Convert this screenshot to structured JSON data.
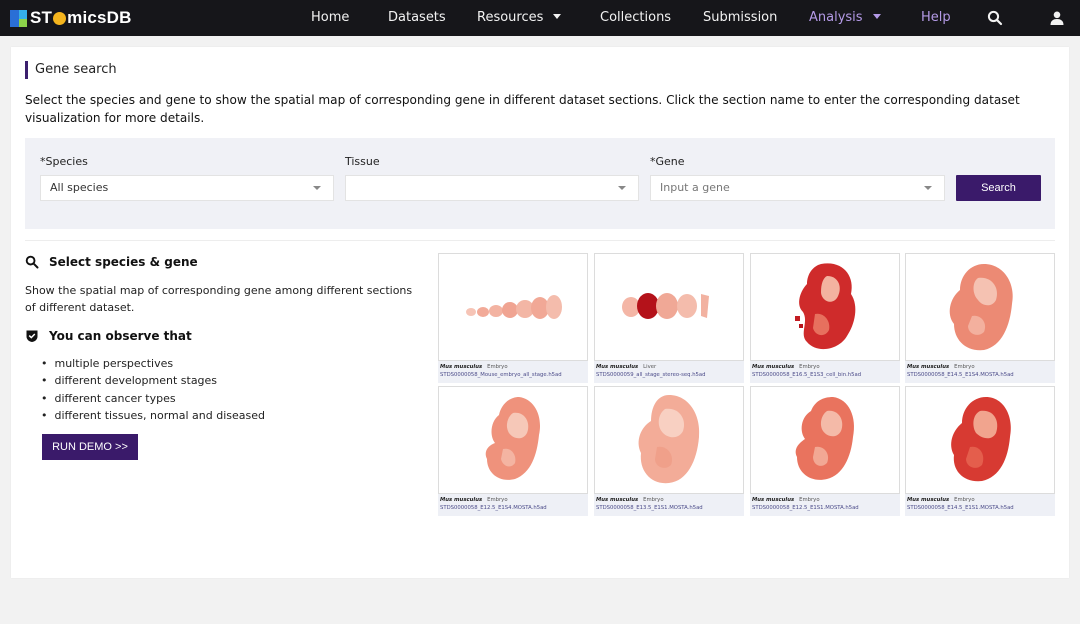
{
  "nav": {
    "brand": {
      "before": "ST",
      "after": "micsDB"
    },
    "items": [
      {
        "label": "Home",
        "dropdown": false,
        "active": false
      },
      {
        "label": "Datasets",
        "dropdown": false,
        "active": false
      },
      {
        "label": "Resources",
        "dropdown": true,
        "active": false
      },
      {
        "label": "Collections",
        "dropdown": false,
        "active": false
      },
      {
        "label": "Submission",
        "dropdown": false,
        "active": false
      },
      {
        "label": "Analysis",
        "dropdown": true,
        "active": true
      },
      {
        "label": "Help",
        "dropdown": false,
        "active": true
      }
    ],
    "icons": [
      "search-icon",
      "user-icon"
    ],
    "colors": {
      "bar": "#16161a",
      "active": "#b49ae6"
    }
  },
  "page": {
    "title": "Gene search",
    "intro": "Select the species and gene to show the spatial map of corresponding gene in different dataset sections. Click the section name to enter the corresponding dataset visualization for more details."
  },
  "filters": {
    "species": {
      "label": "*Species",
      "value": "All species"
    },
    "tissue": {
      "label": "Tissue",
      "value": ""
    },
    "gene": {
      "label": "*Gene",
      "placeholder": "Input a gene"
    },
    "search_label": "Search"
  },
  "info": {
    "heading": "Select species & gene",
    "description": "Show the spatial map of corresponding gene among different sections of different dataset.",
    "observe_heading": "You can observe that",
    "observations": [
      "multiple perspectives",
      "different development stages",
      "different cancer types",
      "different tissues, normal and diseased"
    ],
    "demo_label": "RUN DEMO >>"
  },
  "gallery": [
    {
      "species": "Mus musculus",
      "tissue": "Embryo",
      "dataset": "STDS0000058_Mouse_embryo_all_stage.h5ad"
    },
    {
      "species": "Mus musculus",
      "tissue": "Liver",
      "dataset": "STDS0000059_all_stage_stereo-seq.h5ad"
    },
    {
      "species": "Mus musculus",
      "tissue": "Embryo",
      "dataset": "STDS0000058_E16.5_E1S3_cell_bin.h5ad"
    },
    {
      "species": "Mus musculus",
      "tissue": "Embryo",
      "dataset": "STDS0000058_E14.5_E1S4.MOSTA.h5ad"
    },
    {
      "species": "Mus musculus",
      "tissue": "Embryo",
      "dataset": "STDS0000058_E12.5_E1S4.MOSTA.h5ad"
    },
    {
      "species": "Mus musculus",
      "tissue": "Embryo",
      "dataset": "STDS0000058_E13.5_E1S1.MOSTA.h5ad"
    },
    {
      "species": "Mus musculus",
      "tissue": "Embryo",
      "dataset": "STDS0000058_E12.5_E1S1.MOSTA.h5ad"
    },
    {
      "species": "Mus musculus",
      "tissue": "Embryo",
      "dataset": "STDS0000058_E14.5_E1S1.MOSTA.h5ad"
    }
  ],
  "colors": {
    "accent": "#3a1a6a",
    "spot_light": "#f4b8a8",
    "spot_dark": "#a80f17"
  }
}
